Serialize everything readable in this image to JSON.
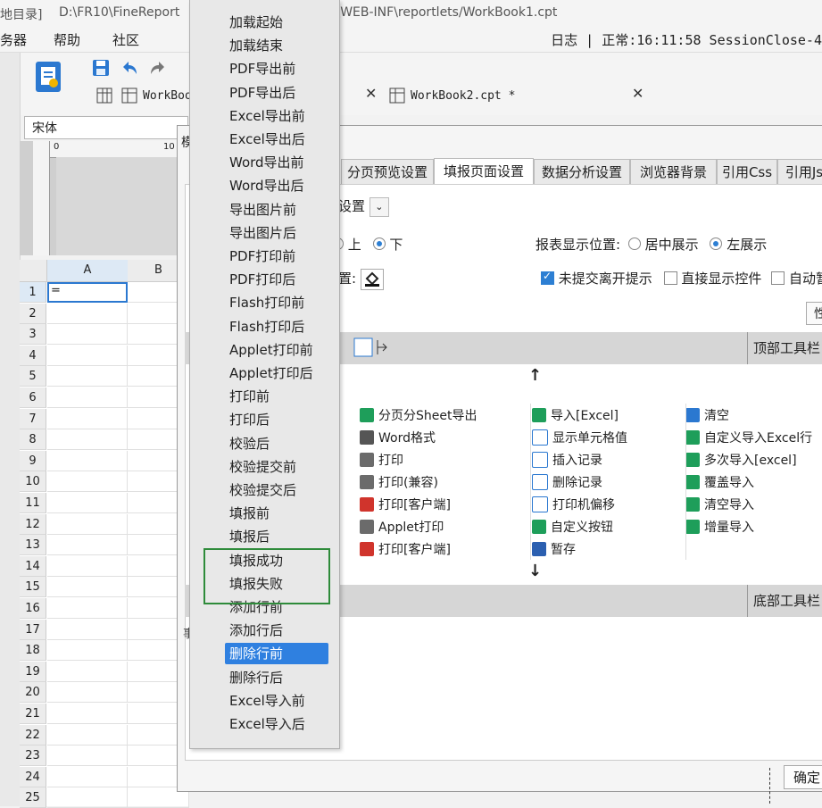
{
  "titlebar": {
    "left_text": "地目录]",
    "path_left": "D:\\FR10\\FineReport",
    "path_right": "t\\WEB-INF\\reportlets/WorkBook1.cpt"
  },
  "menubar": {
    "items": [
      "务器",
      "帮助",
      "社区"
    ],
    "status": "日志 | 正常:16:11:58 SessionClose-4"
  },
  "tabs": [
    {
      "label": "WorkBoo"
    },
    {
      "label": "WorkBook2.cpt *"
    }
  ],
  "font": {
    "name": "宋体"
  },
  "ruler": {
    "mark0": "0",
    "mark10": "10"
  },
  "grid": {
    "columns": [
      "A",
      "B"
    ],
    "rows": [
      "1",
      "2",
      "3",
      "4",
      "5",
      "6",
      "7",
      "8",
      "9",
      "10",
      "11",
      "12",
      "13",
      "14",
      "15",
      "16",
      "17",
      "18",
      "19",
      "20",
      "21",
      "22",
      "23",
      "24",
      "25"
    ],
    "a1_value": "="
  },
  "dialog": {
    "title_char": "模",
    "tabs": [
      "分页预览设置",
      "填报页面设置",
      "数据分析设置",
      "浏览器背景",
      "引用Css",
      "引用Js"
    ],
    "active_tab": "填报页面设置",
    "settings_dropdown": "设置",
    "position_options": {
      "up": "上",
      "down": "下"
    },
    "display_position_label": "报表显示位置:",
    "display_position_options": [
      "居中展示",
      "左展示"
    ],
    "color_label": "置:",
    "checkboxes": [
      {
        "label": "未提交离开提示",
        "checked": true
      },
      {
        "label": "直接显示控件",
        "checked": false
      },
      {
        "label": "自动暂",
        "checked": false
      }
    ],
    "top_toolbar_label": "顶部工具栏",
    "bottom_toolbar_label": "底部工具栏",
    "buttons_col1": [
      "分页分Sheet导出",
      "Word格式",
      "打印",
      "打印(兼容)",
      "打印[客户端]",
      "Applet打印",
      "打印[客户端]"
    ],
    "buttons_col2": [
      "导入[Excel]",
      "显示单元格值",
      "插入记录",
      "删除记录",
      "打印机偏移",
      "自定义按钮",
      "暂存"
    ],
    "buttons_col3": [
      "清空",
      "自定义导入Excel行",
      "多次导入[excel]",
      "覆盖导入",
      "清空导入",
      "增量导入"
    ],
    "ok_label": "确定",
    "right_edge_label": "性",
    "left_fragment": "事"
  },
  "event_menu": {
    "items": [
      "加载起始",
      "加载结束",
      "PDF导出前",
      "PDF导出后",
      "Excel导出前",
      "Excel导出后",
      "Word导出前",
      "Word导出后",
      "导出图片前",
      "导出图片后",
      "PDF打印前",
      "PDF打印后",
      "Flash打印前",
      "Flash打印后",
      "Applet打印前",
      "Applet打印后",
      "打印前",
      "打印后",
      "校验后",
      "校验提交前",
      "校验提交后",
      "填报前",
      "填报后",
      "填报成功",
      "填报失败",
      "添加行前",
      "添加行后",
      "删除行前",
      "删除行后",
      "Excel导入前",
      "Excel导入后"
    ],
    "selected": "删除行前",
    "highlighted": [
      "填报成功",
      "填报失败"
    ]
  },
  "colors": {
    "accent": "#2f80e0",
    "highlight_box": "#2e8b3a",
    "toolbar_band": "#d6d6d6"
  }
}
